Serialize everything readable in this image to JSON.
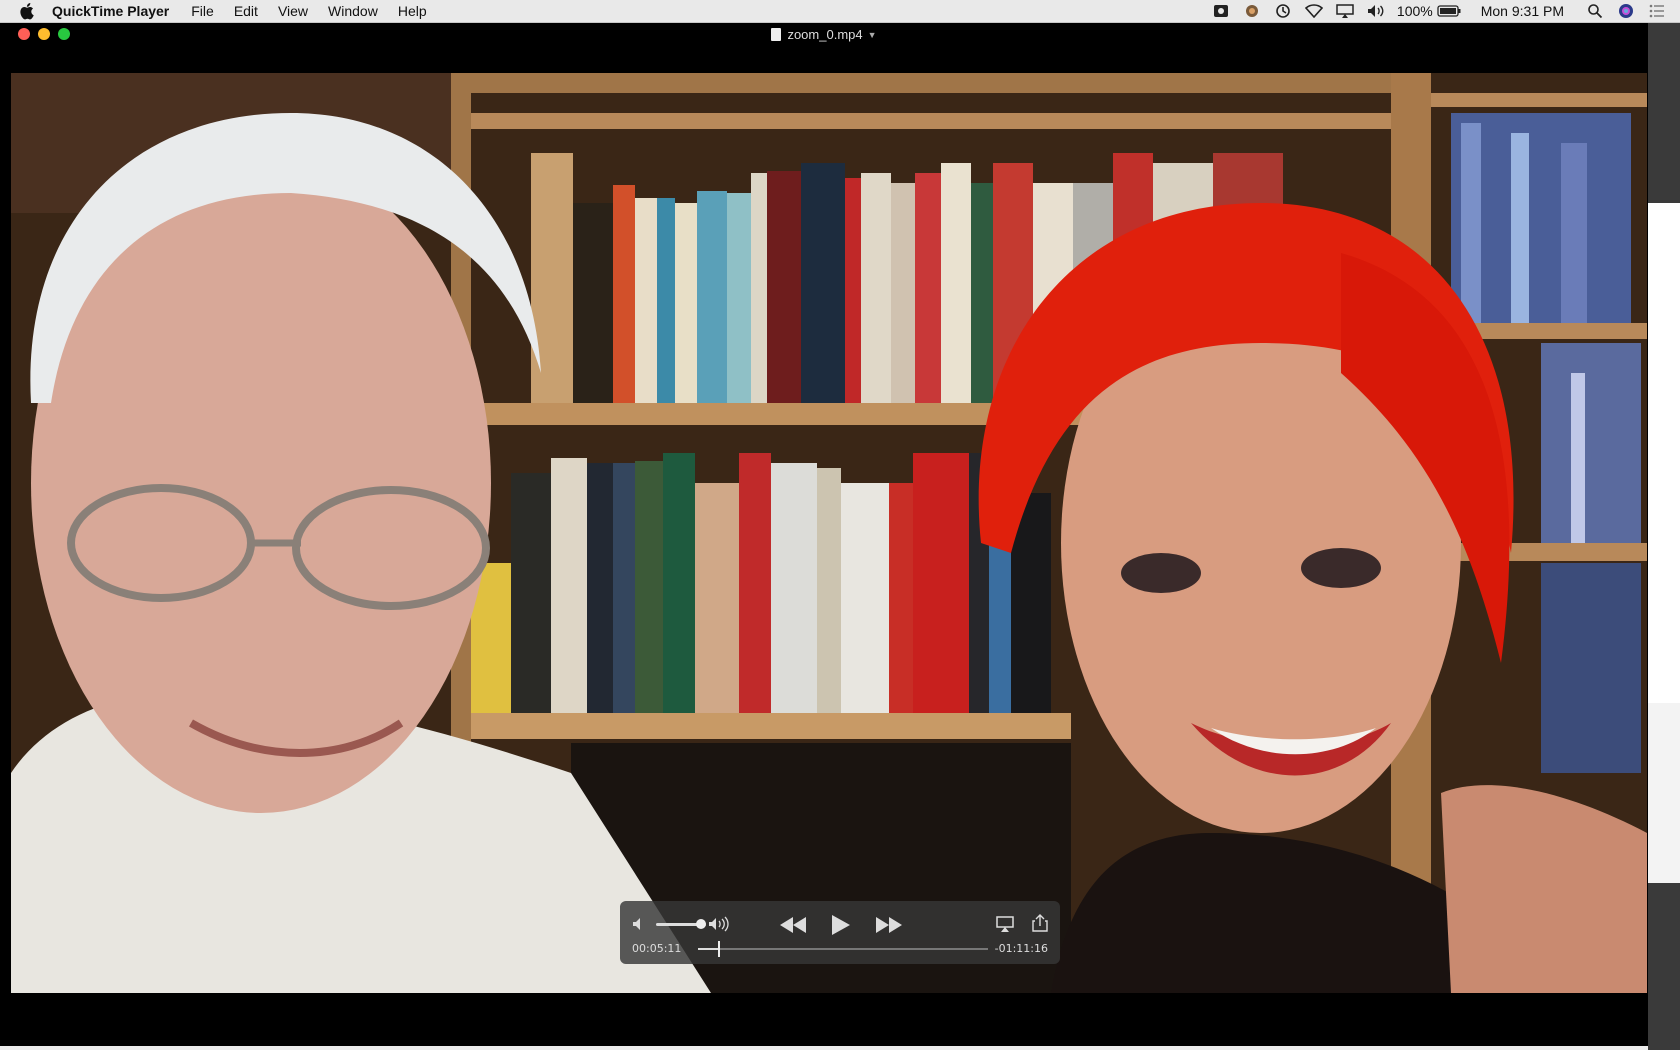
{
  "menubar": {
    "app_name": "QuickTime Player",
    "items": [
      "File",
      "Edit",
      "View",
      "Window",
      "Help"
    ],
    "battery": "100%",
    "clock": "Mon 9:31 PM"
  },
  "window": {
    "title": "zoom_0.mp4"
  },
  "controls": {
    "current_time": "00:05:11",
    "remaining_time": "-01:11:16",
    "progress_fraction": 0.07,
    "volume_fraction": 0.9
  }
}
